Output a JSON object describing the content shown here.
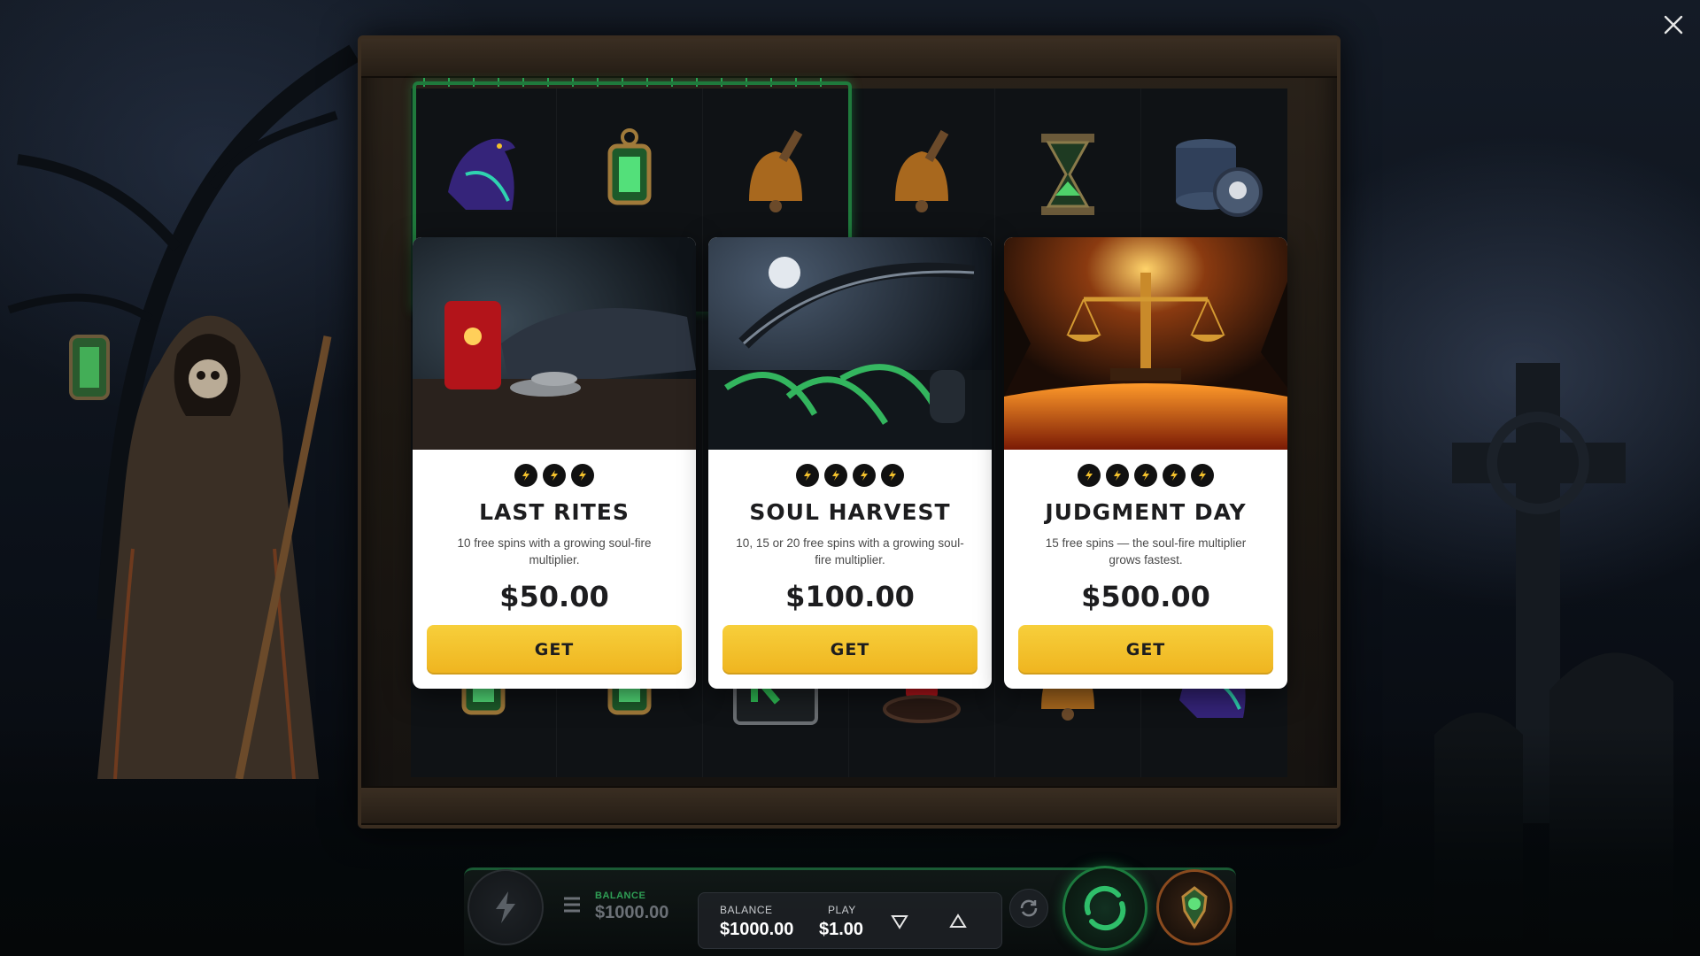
{
  "offers": [
    {
      "bolts": 3,
      "title": "LAST RITES",
      "description": "10 free spins with a growing soul-fire multiplier.",
      "price": "$50.00",
      "button_label": "GET"
    },
    {
      "bolts": 4,
      "title": "SOUL HARVEST",
      "description": "10, 15 or 20 free spins with a growing soul-fire multiplier.",
      "price": "$100.00",
      "button_label": "GET"
    },
    {
      "bolts": 5,
      "title": "JUDGMENT DAY",
      "description": "15 free spins — the soul-fire multiplier grows fastest.",
      "price": "$500.00",
      "button_label": "GET"
    }
  ],
  "hud": {
    "background_balance_label": "BALANCE",
    "background_balance_value": "$1000.00",
    "balance_label": "BALANCE",
    "balance_value": "$1000.00",
    "play_label": "PLAY",
    "play_value": "$1.00"
  },
  "reel_symbols": [
    "raven",
    "lantern",
    "bell",
    "bell",
    "hourglass",
    "coin-stack",
    "lantern",
    "lantern",
    "k-card",
    "candle",
    "bell",
    "raven"
  ],
  "icons": {
    "close": "close-icon",
    "bolt": "lightning-bolt-icon",
    "menu": "hamburger-menu-icon",
    "autoplay": "autoplay-icon",
    "spin": "spin-icon",
    "bonus": "bonus-icon"
  },
  "colors": {
    "accent_gold": "#f3c12c",
    "win_line_green": "#1f7a3c",
    "card_bg": "#ffffff",
    "title_text": "#1d1d1f"
  }
}
